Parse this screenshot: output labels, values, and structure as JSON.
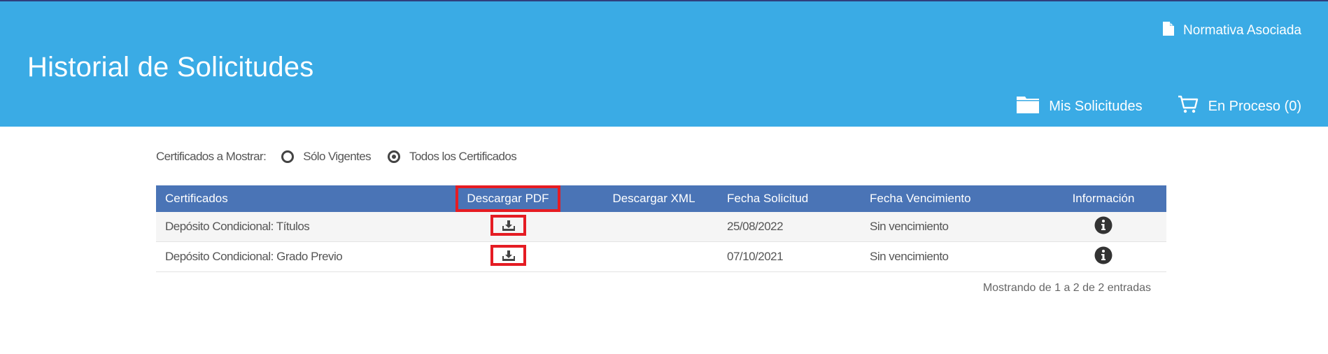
{
  "header": {
    "title": "Historial de Solicitudes",
    "normativa_label": "Normativa Asociada",
    "mis_solicitudes_label": "Mis Solicitudes",
    "en_proceso_label": "En Proceso (0)",
    "background_color": "#3aabe5"
  },
  "filter": {
    "label": "Certificados a Mostrar:",
    "options": [
      {
        "label": "Sólo Vigentes",
        "selected": false
      },
      {
        "label": "Todos los Certificados",
        "selected": true
      }
    ]
  },
  "table": {
    "header_color": "#4a74b6",
    "columns": [
      "Certificados",
      "Descargar PDF",
      "Descargar XML",
      "Fecha Solicitud",
      "Fecha Vencimiento",
      "Información"
    ],
    "rows": [
      {
        "certificado": "Depósito Condicional: Títulos",
        "fecha_solicitud": "25/08/2022",
        "fecha_vencimiento": "Sin vencimiento"
      },
      {
        "certificado": "Depósito Condicional: Grado Previo",
        "fecha_solicitud": "07/10/2021",
        "fecha_vencimiento": "Sin vencimiento"
      }
    ]
  },
  "footer": {
    "info_text": "Mostrando de 1 a 2 de 2 entradas"
  },
  "icons": {
    "normativa": "document-icon",
    "mis_solicitudes": "folder-icon",
    "en_proceso": "cart-icon",
    "download": "download-icon",
    "info": "info-icon"
  },
  "highlight_color": "#e51c23"
}
